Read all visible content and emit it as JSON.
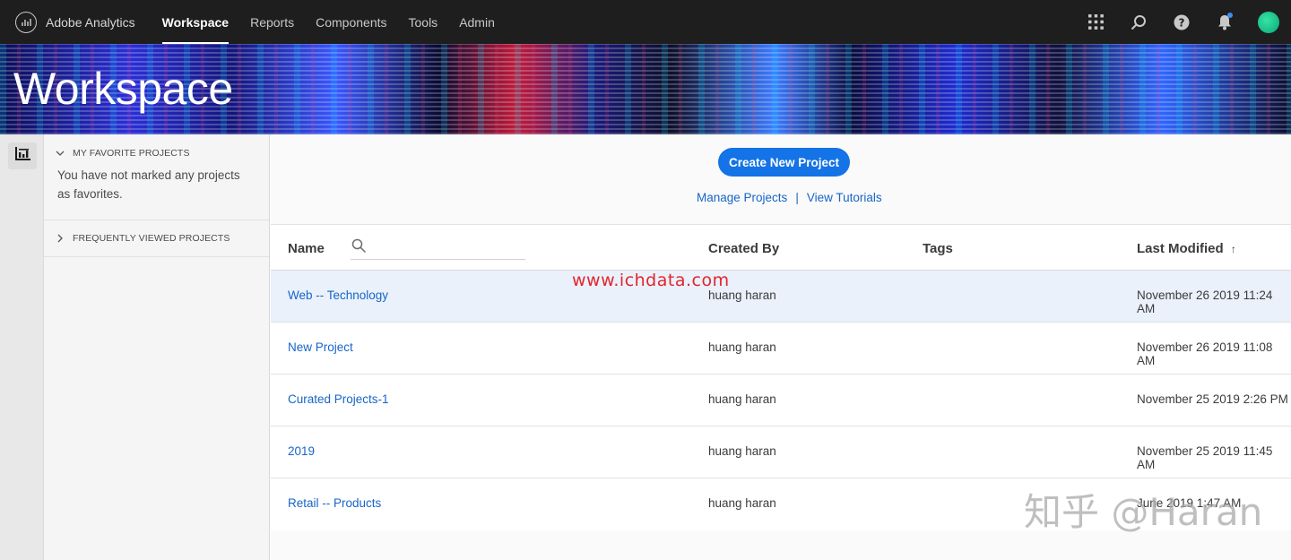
{
  "topbar": {
    "app_name": "Adobe Analytics",
    "nav": [
      {
        "label": "Workspace",
        "active": true
      },
      {
        "label": "Reports",
        "active": false
      },
      {
        "label": "Components",
        "active": false
      },
      {
        "label": "Tools",
        "active": false
      },
      {
        "label": "Admin",
        "active": false
      }
    ],
    "icons": [
      "apps-grid-icon",
      "search-icon",
      "help-icon",
      "bell-icon",
      "avatar"
    ]
  },
  "banner": {
    "title": "Workspace"
  },
  "sidebar": {
    "favorites_title": "MY FAVORITE PROJECTS",
    "favorites_empty_text": "You have not marked any projects as favorites.",
    "frequent_title": "FREQUENTLY VIEWED PROJECTS"
  },
  "main": {
    "create_button": "Create New Project",
    "manage_link": "Manage Projects",
    "separator": "|",
    "tutorials_link": "View Tutorials"
  },
  "table": {
    "columns": {
      "name": "Name",
      "created_by": "Created By",
      "tags": "Tags",
      "last_modified": "Last Modified"
    },
    "sort_indicator": "↑",
    "rows": [
      {
        "name": "Web -- Technology",
        "created_by": "huang haran",
        "tags": "",
        "last_modified": "November 26 2019 11:24 AM"
      },
      {
        "name": "New Project",
        "created_by": "huang haran",
        "tags": "",
        "last_modified": "November 26 2019 11:08 AM"
      },
      {
        "name": "Curated Projects-1",
        "created_by": "huang haran",
        "tags": "",
        "last_modified": "November 25 2019 2:26 PM"
      },
      {
        "name": "2019",
        "created_by": "huang haran",
        "tags": "",
        "last_modified": "November 25 2019 11:45 AM"
      },
      {
        "name": "Retail -- Products",
        "created_by": "huang haran",
        "tags": "",
        "last_modified": "June 2019 1:47 AM"
      }
    ]
  },
  "watermarks": {
    "site": "www.ichdata.com",
    "zhihu": "知乎 @Haran"
  },
  "colors": {
    "topbar_bg": "#1e1e1e",
    "accent_blue": "#1473e6",
    "link_blue": "#1765c6",
    "avatar_green": "#1fc790"
  }
}
